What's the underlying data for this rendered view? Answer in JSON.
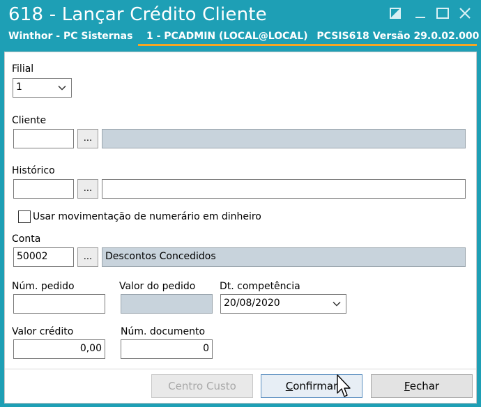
{
  "window": {
    "title": "618 - Lançar Crédito Cliente",
    "company": "Winthor - PC Sisternas",
    "user": "1 - PCADMIN (LOCAL@LOCAL)",
    "routine": "PCSIS618",
    "version_label": "Versão",
    "version": "29.0.02.000"
  },
  "form": {
    "filial": {
      "label": "Filial",
      "value": "1"
    },
    "cliente": {
      "label": "Cliente",
      "code": "",
      "lookup": "...",
      "name": ""
    },
    "historico": {
      "label": "Histórico",
      "code": "",
      "lookup": "...",
      "text": ""
    },
    "usar_movimentacao": {
      "label": "Usar movimentação de numerário em dinheiro",
      "checked": false
    },
    "conta": {
      "label": "Conta",
      "code": "50002",
      "lookup": "...",
      "name": "Descontos Concedidos"
    },
    "num_pedido": {
      "label": "Núm. pedido",
      "value": ""
    },
    "valor_pedido": {
      "label": "Valor do pedido",
      "value": ""
    },
    "dt_competencia": {
      "label": "Dt. competência",
      "value": "20/08/2020"
    },
    "valor_credito": {
      "label": "Valor crédito",
      "value": "0,00"
    },
    "num_documento": {
      "label": "Núm. documento",
      "value": "0"
    }
  },
  "buttons": {
    "centro_custo": "Centro Custo",
    "confirmar_first": "C",
    "confirmar_rest": "onfirmar",
    "fechar_first": "F",
    "fechar_rest": "echar"
  },
  "colors": {
    "titlebar": "#1e9fb5",
    "accent": "#f5a623",
    "readonly_field": "#c8d3dc"
  }
}
